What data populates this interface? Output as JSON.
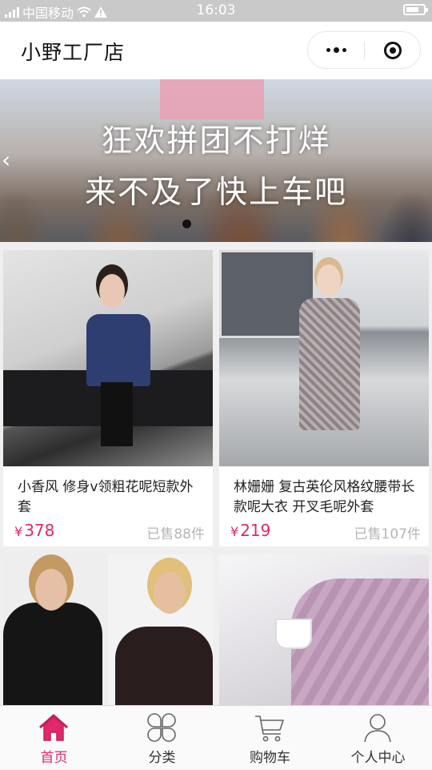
{
  "status_bar": {
    "carrier": "中国移动",
    "time": "16:03",
    "battery_level": 0.75
  },
  "header": {
    "title": "小野工厂店"
  },
  "banner": {
    "line1": "狂欢拼团不打烊",
    "line2": "来不及了快上车吧",
    "current_slide": 1
  },
  "products": [
    {
      "name": "小香风 修身v领粗花呢短款外套",
      "currency": "¥",
      "price": "378",
      "sold": "已售88件"
    },
    {
      "name": "林姗姗 复古英伦风格纹腰带长款呢大衣 开叉毛呢外套",
      "currency": "¥",
      "price": "219",
      "sold": "已售107件"
    },
    {
      "name": "",
      "currency": "",
      "price": "",
      "sold": ""
    },
    {
      "name": "",
      "currency": "",
      "price": "",
      "sold": ""
    }
  ],
  "tabbar": {
    "active": "home",
    "items": [
      {
        "key": "home",
        "label": "首页",
        "icon": "home-icon"
      },
      {
        "key": "category",
        "label": "分类",
        "icon": "category-icon"
      },
      {
        "key": "cart",
        "label": "购物车",
        "icon": "cart-icon"
      },
      {
        "key": "me",
        "label": "个人中心",
        "icon": "profile-icon"
      }
    ]
  },
  "colors": {
    "accent": "#e0286a",
    "status_bar_bg": "#c9c9c9",
    "sold_text": "#b5b5b5"
  }
}
